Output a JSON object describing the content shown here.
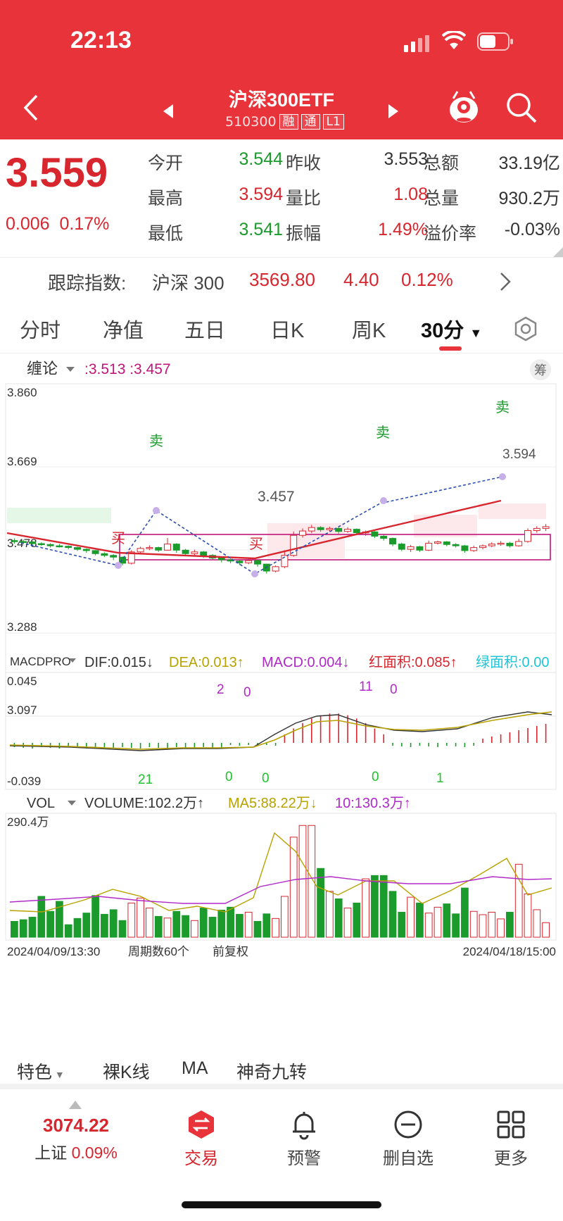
{
  "status": {
    "time": "22:13"
  },
  "header": {
    "title": "沪深300ETF",
    "code": "510300",
    "tags": [
      "融",
      "通",
      "L1"
    ]
  },
  "quote": {
    "price": "3.559",
    "change": "0.006",
    "change_pct": "0.17%",
    "rows": [
      [
        {
          "label": "今开",
          "value": "3.544",
          "color": "#1a9b2c"
        },
        {
          "label": "昨收",
          "value": "3.553",
          "color": "#333333"
        },
        {
          "label": "总额",
          "value": "33.19亿",
          "color": "#333333"
        }
      ],
      [
        {
          "label": "最高",
          "value": "3.594",
          "color": "#d7262e"
        },
        {
          "label": "量比",
          "value": "1.08",
          "color": "#d7262e"
        },
        {
          "label": "总量",
          "value": "930.2万",
          "color": "#333333"
        }
      ],
      [
        {
          "label": "最低",
          "value": "3.541",
          "color": "#1a9b2c"
        },
        {
          "label": "振幅",
          "value": "1.49%",
          "color": "#d7262e"
        },
        {
          "label": "溢价率",
          "value": "-0.03%",
          "color": "#333333"
        }
      ]
    ]
  },
  "tracking": {
    "label": "跟踪指数:",
    "index": "沪深 300",
    "value": "3569.80",
    "change": "4.40",
    "pct": "0.12%"
  },
  "tabs": [
    "分时",
    "净值",
    "五日",
    "日K",
    "周K",
    "30分"
  ],
  "main_chart": {
    "indicator": "缠论",
    "indicator_values": ":3.513 :3.457",
    "chip_label": "筹",
    "y_labels": [
      "3.860",
      "3.669",
      "3.478",
      "3.288",
      "3.097"
    ],
    "buy_label": "买",
    "sell_label": "卖",
    "center_label": "3.457",
    "high_label": "3.594"
  },
  "macd": {
    "name": "MACDPRO",
    "dif": "DIF:0.015↓",
    "dea": "DEA:0.013↑",
    "macd": "MACD:0.004↓",
    "red_area": "红面积:0.085↑",
    "green_area": "绿面积:0.00",
    "y_top": "0.045",
    "y_bottom": "-0.039",
    "counts": [
      "2",
      "0",
      "11",
      "0",
      "21",
      "0",
      "0",
      "0",
      "1"
    ]
  },
  "volume": {
    "name": "VOL",
    "volume": "VOLUME:102.2万↑",
    "ma5": "MA5:88.22万↓",
    "ma10": "10:130.3万↑",
    "y_top": "290.4万",
    "start": "2024/04/09/13:30",
    "period": "周期数60个",
    "adjust": "前复权",
    "end": "2024/04/18/15:00"
  },
  "bottom_bar": [
    "特色",
    "裸K线",
    "MA",
    "神奇九转"
  ],
  "dock": {
    "index_value": "3074.22",
    "index_name": "上证",
    "index_pct": "0.09%",
    "items": [
      "交易",
      "预警",
      "删自选",
      "更多"
    ]
  },
  "chart_data": [
    {
      "type": "candlestick",
      "title": "沪深300ETF 30分",
      "ylim": [
        3.097,
        3.86
      ],
      "ticks": [
        3.86,
        3.669,
        3.478,
        3.288,
        3.097
      ],
      "candles": [
        [
          3.5,
          3.498,
          3.505,
          3.493
        ],
        [
          3.498,
          3.497,
          3.502,
          3.493
        ],
        [
          3.497,
          3.493,
          3.499,
          3.49
        ],
        [
          3.493,
          3.491,
          3.496,
          3.488
        ],
        [
          3.491,
          3.488,
          3.494,
          3.484
        ],
        [
          3.488,
          3.487,
          3.492,
          3.484
        ],
        [
          3.487,
          3.484,
          3.489,
          3.48
        ],
        [
          3.484,
          3.48,
          3.486,
          3.476
        ],
        [
          3.48,
          3.477,
          3.482,
          3.472
        ],
        [
          3.477,
          3.47,
          3.478,
          3.466
        ],
        [
          3.47,
          3.466,
          3.473,
          3.462
        ],
        [
          3.466,
          3.462,
          3.469,
          3.455
        ],
        [
          3.462,
          3.448,
          3.463,
          3.443
        ],
        [
          3.448,
          3.474,
          3.478,
          3.445
        ],
        [
          3.474,
          3.482,
          3.486,
          3.47
        ],
        [
          3.482,
          3.484,
          3.489,
          3.478
        ],
        [
          3.484,
          3.478,
          3.486,
          3.474
        ],
        [
          3.478,
          3.492,
          3.506,
          3.477
        ],
        [
          3.492,
          3.478,
          3.494,
          3.472
        ],
        [
          3.478,
          3.47,
          3.481,
          3.466
        ],
        [
          3.47,
          3.474,
          3.479,
          3.466
        ],
        [
          3.474,
          3.466,
          3.476,
          3.46
        ],
        [
          3.466,
          3.46,
          3.469,
          3.456
        ],
        [
          3.46,
          3.456,
          3.463,
          3.45
        ],
        [
          3.456,
          3.453,
          3.459,
          3.448
        ],
        [
          3.453,
          3.449,
          3.455,
          3.444
        ],
        [
          3.449,
          3.454,
          3.458,
          3.446
        ],
        [
          3.454,
          3.446,
          3.456,
          3.44
        ],
        [
          3.446,
          3.43,
          3.447,
          3.424
        ],
        [
          3.43,
          3.44,
          3.443,
          3.427
        ],
        [
          3.44,
          3.466,
          3.478,
          3.437
        ],
        [
          3.466,
          3.512,
          3.521,
          3.463
        ],
        [
          3.512,
          3.522,
          3.528,
          3.507
        ],
        [
          3.522,
          3.53,
          3.536,
          3.517
        ],
        [
          3.53,
          3.525,
          3.533,
          3.52
        ],
        [
          3.525,
          3.528,
          3.532,
          3.521
        ],
        [
          3.528,
          3.521,
          3.53,
          3.516
        ],
        [
          3.521,
          3.526,
          3.531,
          3.518
        ],
        [
          3.526,
          3.518,
          3.528,
          3.514
        ],
        [
          3.518,
          3.52,
          3.523,
          3.511
        ],
        [
          3.52,
          3.51,
          3.522,
          3.506
        ],
        [
          3.51,
          3.505,
          3.513,
          3.5
        ],
        [
          3.505,
          3.492,
          3.507,
          3.487
        ],
        [
          3.492,
          3.48,
          3.495,
          3.476
        ],
        [
          3.48,
          3.486,
          3.49,
          3.474
        ],
        [
          3.486,
          3.478,
          3.488,
          3.474
        ],
        [
          3.478,
          3.494,
          3.5,
          3.476
        ],
        [
          3.494,
          3.497,
          3.5,
          3.491
        ],
        [
          3.497,
          3.491,
          3.499,
          3.487
        ],
        [
          3.491,
          3.488,
          3.494,
          3.484
        ],
        [
          3.488,
          3.477,
          3.49,
          3.472
        ],
        [
          3.477,
          3.484,
          3.488,
          3.474
        ],
        [
          3.484,
          3.488,
          3.491,
          3.48
        ],
        [
          3.488,
          3.492,
          3.496,
          3.485
        ],
        [
          3.492,
          3.494,
          3.499,
          3.488
        ],
        [
          3.494,
          3.488,
          3.497,
          3.484
        ],
        [
          3.488,
          3.498,
          3.504,
          3.486
        ],
        [
          3.498,
          3.523,
          3.528,
          3.495
        ],
        [
          3.523,
          3.528,
          3.533,
          3.518
        ],
        [
          3.528,
          3.532,
          3.538,
          3.522
        ]
      ]
    },
    {
      "type": "bar",
      "title": "VOL",
      "ylim": [
        0,
        290.4
      ],
      "values": [
        38,
        42,
        48,
        98,
        62,
        86,
        30,
        45,
        58,
        100,
        55,
        66,
        40,
        82,
        94,
        70,
        50,
        46,
        62,
        52,
        40,
        70,
        48,
        65,
        72,
        55,
        60,
        38,
        56,
        45,
        98,
        240,
        268,
        268,
        165,
        110,
        92,
        70,
        82,
        140,
        148,
        148,
        110,
        60,
        96,
        82,
        58,
        72,
        80,
        56,
        118,
        62,
        54,
        60,
        44,
        60,
        175,
        104,
        66,
        35
      ]
    }
  ]
}
